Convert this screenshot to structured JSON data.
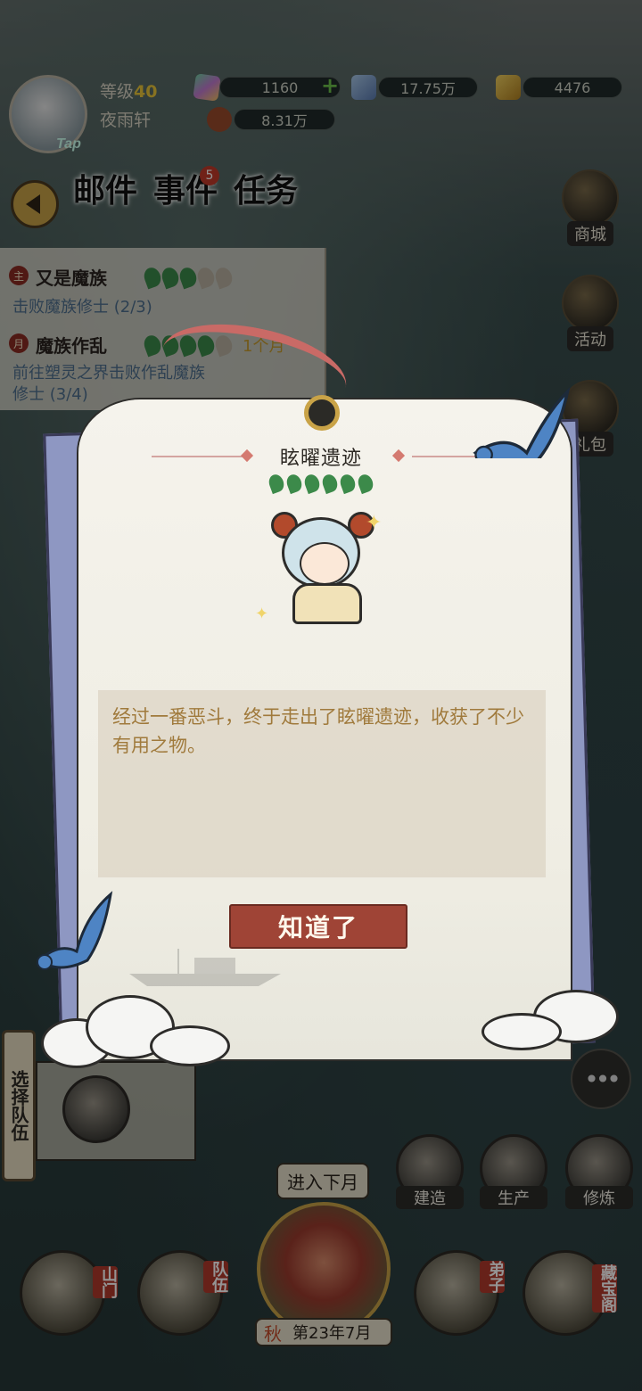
{
  "player": {
    "level_label": "等级",
    "level": "40",
    "name": "夜雨轩",
    "avatar_badge": "Tap"
  },
  "resources": {
    "jade": "1160",
    "spirit_stone": "17.75万",
    "gold": "4476",
    "meat": "8.31万"
  },
  "tabs": {
    "mail": "邮件",
    "events": "事件",
    "events_badge": "5",
    "tasks": "任务"
  },
  "quests": [
    {
      "mark": "主",
      "title": "又是魔族",
      "desc": "击败魔族修士 (2/3)"
    },
    {
      "mark": "月",
      "title": "魔族作乱",
      "duration": "1个月",
      "desc_line1": "前往塑灵之界击败作乱魔族",
      "desc_line2": "修士 (3/4)"
    }
  ],
  "side_menu": {
    "shop": "商城",
    "activity": "活动",
    "gift": "礼包"
  },
  "dialog": {
    "title": "眩曜遗迹",
    "body": "经过一番恶斗，终于走出了眩曜遗迹，收获了不少有用之物。",
    "confirm": "知道了"
  },
  "bottom": {
    "select_team": "选择队伍",
    "build": "建造",
    "produce": "生产",
    "cultivate": "修炼",
    "next_month": "进入下月",
    "season": "秋",
    "date": "第23年7月",
    "nav_sect": "山门",
    "nav_team": "队伍",
    "nav_disciple": "弟子",
    "nav_treasure": "藏宝阁"
  },
  "colors": {
    "accent_red": "#9f4436",
    "gold": "#c9a347",
    "text_gold": "#a07a3c",
    "quest_green": "#3c8a4a"
  }
}
